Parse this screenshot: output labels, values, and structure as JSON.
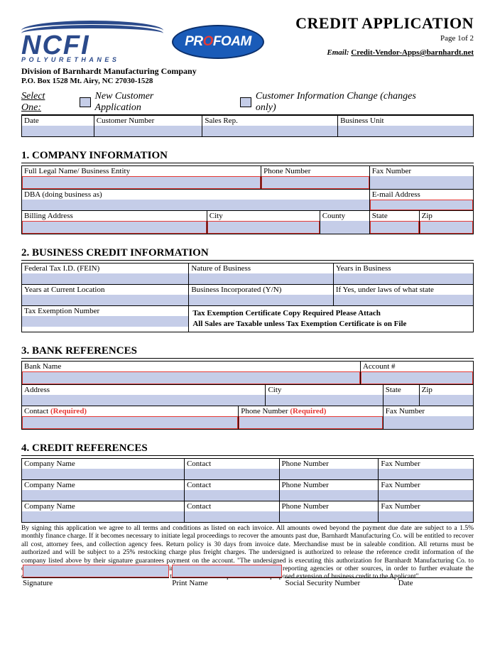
{
  "header": {
    "title": "CREDIT APPLICATION",
    "page": "Page 1of 2",
    "email_label": "Email:",
    "email": "Credit-Vendor-Apps@barnhardt.net",
    "logo_main": "NCFI",
    "logo_sub": "POLYURETHANES",
    "profoam_pre": "PR",
    "profoam_post": "FOAM",
    "division": "Division of Barnhardt Manufacturing Company",
    "pobox": "P.O. Box 1528 Mt. Airy, NC 27030-1528"
  },
  "select": {
    "label": "Select One:",
    "opt1": "New Customer Application",
    "opt2": "Customer Information Change (changes only)"
  },
  "top_row": {
    "date": "Date",
    "cust_num": "Customer Number",
    "sales_rep": "Sales Rep.",
    "bus_unit": "Business Unit"
  },
  "s1": {
    "title": "1.  COMPANY INFORMATION",
    "legal_name": "Full Legal Name/ Business Entity",
    "phone": "Phone Number",
    "fax": "Fax Number",
    "dba": "DBA (doing business as)",
    "email": "E-mail Address",
    "billing": "Billing Address",
    "city": "City",
    "county": "County",
    "state": "State",
    "zip": "Zip"
  },
  "s2": {
    "title": "2.  BUSINESS CREDIT INFORMATION",
    "fein": "Federal Tax I.D. (FEIN)",
    "nature": "Nature of Business",
    "years_biz": "Years in Business",
    "years_loc": "Years at Current Location",
    "incorp": "Business Incorporated (Y/N)",
    "laws": "If Yes, under laws of what state",
    "tax_exempt": "Tax Exemption Number",
    "tax_note1": "Tax Exemption Certificate Copy Required Please Attach",
    "tax_note2": "All Sales are Taxable unless Tax Exemption Certificate is on File"
  },
  "s3": {
    "title": "3.  BANK REFERENCES",
    "bank": "Bank Name",
    "account": "Account #",
    "address": "Address",
    "city": "City",
    "state": "State",
    "zip": "Zip",
    "contact": "Contact ",
    "req": "(Required)",
    "phone": "Phone  Number ",
    "fax": "Fax  Number"
  },
  "s4": {
    "title": "4.  CREDIT REFERENCES",
    "company": "Company Name",
    "contact": "Contact",
    "phone": "Phone Number",
    "fax": "Fax Number"
  },
  "fine_print": "By signing this application we agree to all terms and conditions as listed on each invoice. All amounts owed beyond the payment due date are subject to a 1.5% monthly finance charge. If it becomes necessary to initiate legal proceedings to recover the amounts past due, Barnhardt Manufacturing Co. will be entitled to recover all cost, attorney fees, and collection agency fees. Return policy is 30 days from invoice date. Merchandise must be in saleable condition. All returns must be authorized and will be subject to a 25% restocking charge plus freight charges. The undersigned is authorized to release the reference credit information of the company listed above by their signature guarantees payment on the account. \"The undersigned is executing this authorization for Barnhardt Manufacturing Co. to obtain a consumer credit report on the undersigned individual through credit and consumer reporting agencies or other sources, in order to further evaluate the creditworthiness of such individual in connection with the credit evaluation process and the proposed extension of business credit to the Applicant\".",
  "sig": {
    "signature": "Signature",
    "print": "Print Name",
    "ssn": "Social Security Number",
    "date": "Date"
  }
}
